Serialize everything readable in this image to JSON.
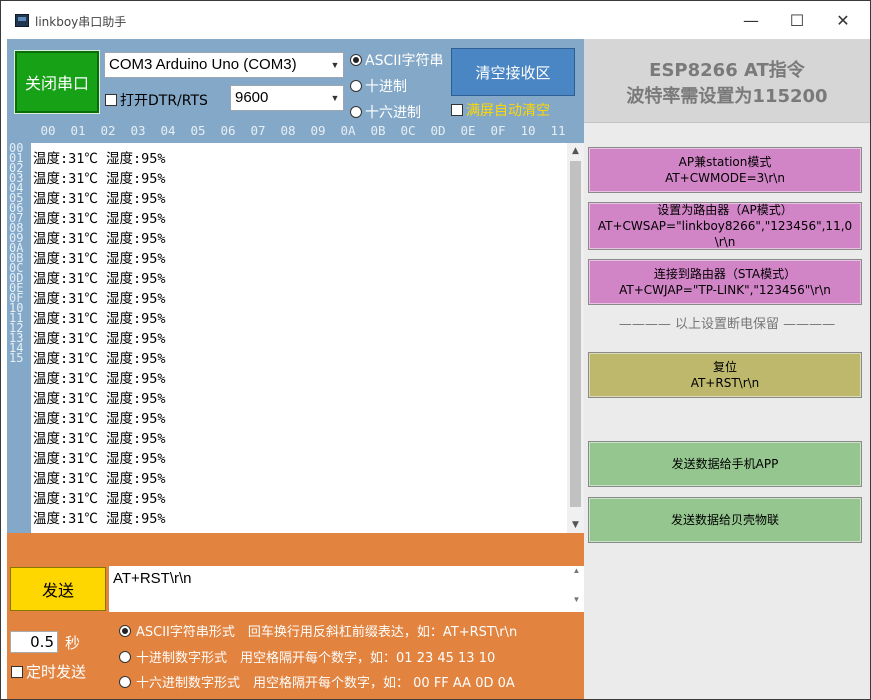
{
  "window": {
    "title": "linkboy串口助手",
    "minimize": "—",
    "maximize": "☐",
    "close": "✕"
  },
  "serial": {
    "close_port_label": "关闭串口",
    "port_value": "COM3 Arduino Uno (COM3)",
    "dtr_label": "打开DTR/RTS",
    "baud_value": "9600",
    "rx_mode_ascii": "ASCII字符串",
    "rx_mode_dec": "十进制",
    "rx_mode_hex": "十六进制",
    "clear_rx_label": "清空接收区",
    "auto_clear_label": "满屏自动清空"
  },
  "hex_columns": [
    "00",
    "01",
    "02",
    "03",
    "04",
    "05",
    "06",
    "07",
    "08",
    "09",
    "0A",
    "0B",
    "0C",
    "0D",
    "0E",
    "0F",
    "10",
    "11"
  ],
  "hex_rows": [
    "00",
    "01",
    "02",
    "03",
    "04",
    "05",
    "06",
    "07",
    "08",
    "09",
    "0A",
    "0B",
    "0C",
    "0D",
    "0E",
    "0F",
    "10",
    "11",
    "12",
    "13",
    "14",
    "15"
  ],
  "rx_lines": [
    "温度:31℃ 湿度:95%",
    "温度:31℃ 湿度:95%",
    "温度:31℃ 湿度:95%",
    "温度:31℃ 湿度:95%",
    "温度:31℃ 湿度:95%",
    "温度:31℃ 湿度:95%",
    "温度:31℃ 湿度:95%",
    "温度:31℃ 湿度:95%",
    "温度:31℃ 湿度:95%",
    "温度:31℃ 湿度:95%",
    "温度:31℃ 湿度:95%",
    "温度:31℃ 湿度:95%",
    "温度:31℃ 湿度:95%",
    "温度:31℃ 湿度:95%",
    "温度:31℃ 湿度:95%",
    "温度:31℃ 湿度:95%",
    "温度:31℃ 湿度:95%",
    "温度:31℃ 湿度:95%",
    "温度:31℃ 湿度:95%"
  ],
  "send": {
    "button_label": "发送",
    "input_value": "AT+RST\\r\\n",
    "interval_value": "0.5",
    "interval_unit": "秒",
    "timer_label": "定时发送",
    "formats": [
      {
        "label": "ASCII字符串形式",
        "hint": "回车换行用反斜杠前缀表达，如：AT+RST\\r\\n"
      },
      {
        "label": "十进制数字形式",
        "hint": "用空格隔开每个数字，如：01 23 45 13 10"
      },
      {
        "label": "十六进制数字形式",
        "hint": "用空格隔开每个数字，如：  00 FF AA 0D 0A"
      }
    ]
  },
  "at_panel": {
    "heading_line1": "ESP8266  AT指令",
    "heading_line2": "波特率需设置为115200",
    "buttons": [
      {
        "line1": "AP兼station模式",
        "line2": "AT+CWMODE=3\\r\\n"
      },
      {
        "line1": "设置为路由器（AP模式）",
        "line2": "AT+CWSAP=\"linkboy8266\",\"123456\",11,0",
        "line3": "\\r\\n"
      },
      {
        "line1": "连接到路由器（STA模式）",
        "line2": "AT+CWJAP=\"TP-LINK\",\"123456\"\\r\\n"
      }
    ],
    "separator": "———— 以上设置断电保留 ————",
    "reset": {
      "line1": "复位",
      "line2": "AT+RST\\r\\n"
    },
    "send_phone": "发送数据给手机APP",
    "send_beike": "发送数据给贝壳物联"
  },
  "colors": {
    "left_panel": "#84a9c8",
    "close_port_button": "#16a116",
    "clear_button": "#4a86c3",
    "auto_clear_text": "#ffd700",
    "bottom_panel": "#e2833f",
    "send_button": "#ffd700",
    "pink_button": "#d184c6",
    "olive_button": "#bdb86c",
    "green_button": "#95c68f"
  }
}
